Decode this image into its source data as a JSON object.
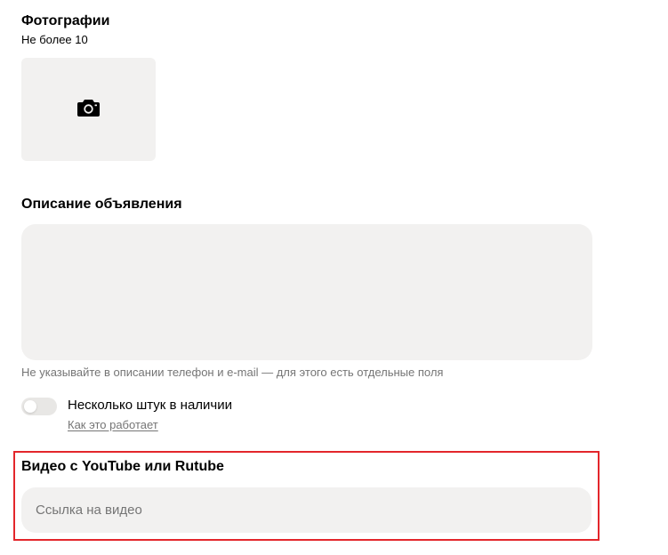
{
  "photos": {
    "title": "Фотографии",
    "subtitle": "Не более 10",
    "icon": "camera-icon"
  },
  "description": {
    "title": "Описание объявления",
    "value": "",
    "hint": "Не указывайте в описании телефон и e-mail — для этого есть отдельные поля"
  },
  "stock": {
    "toggle_label": "Несколько штук в наличии",
    "toggle_on": false,
    "link_label": "Как это работает"
  },
  "video": {
    "title": "Видео с YouTube или Rutube",
    "placeholder": "Ссылка на видео",
    "value": ""
  },
  "colors": {
    "field_bg": "#f2f1f0",
    "highlight": "#e3262b",
    "muted_text": "#757575"
  }
}
